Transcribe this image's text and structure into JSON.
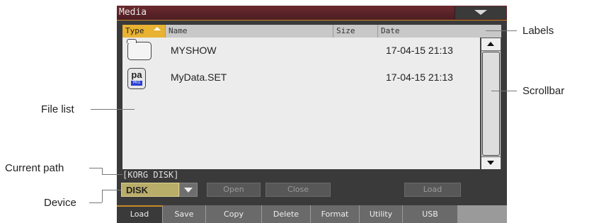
{
  "window": {
    "title": "Media"
  },
  "columns": [
    "Type",
    "Name",
    "Size",
    "Date"
  ],
  "files": [
    {
      "icon": "folder-icon",
      "name": "MYSHOW",
      "size": "",
      "date": "17-04-15 21:13"
    },
    {
      "icon": "pa-package-icon",
      "icon_text": "pa",
      "icon_badge": "PKG",
      "name": "MyData.SET",
      "size": "",
      "date": "17-04-15 21:13"
    }
  ],
  "path": "[KORG DISK]",
  "device": {
    "selected": "DISK"
  },
  "buttons": {
    "open": "Open",
    "close": "Close",
    "load": "Load"
  },
  "tabs": [
    "Load",
    "Save",
    "Copy",
    "Delete",
    "Format",
    "Utility",
    "USB"
  ],
  "callouts": {
    "labels": "Labels",
    "scrollbar": "Scrollbar",
    "file_list": "File list",
    "current_path": "Current path",
    "device": "Device"
  },
  "colors": {
    "title_bar": "#5a2228",
    "selected_header": "#e8b232",
    "device_field": "#b9ad6a",
    "accent": "#c98a2a"
  }
}
